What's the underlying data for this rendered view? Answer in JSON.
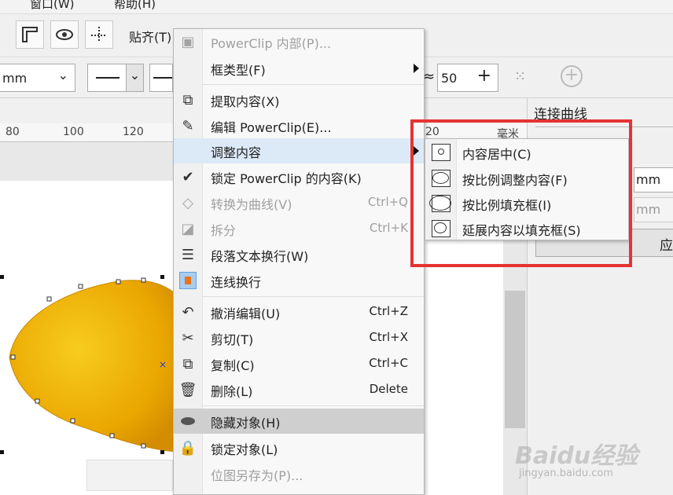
{
  "menubar": {
    "window": "窗口(W)",
    "help": "帮助(H)"
  },
  "toolbar": {
    "snap_label": "贴齐(T)",
    "unit_value": "mm",
    "spin_value": "50"
  },
  "ruler": {
    "ticks": [
      "80",
      "100",
      "120",
      "20"
    ],
    "unit": "毫米"
  },
  "docker": {
    "title": "连接曲线",
    "field_unit1": "mm",
    "field_unit2": "mm",
    "apply_label": "应"
  },
  "context_menu": {
    "items": [
      {
        "label": "PowerClip 内部(P)...",
        "shortcut": "",
        "disabled": true
      },
      {
        "label": "框类型(F)",
        "shortcut": "",
        "submenu": true
      },
      {
        "label": "提取内容(X)",
        "shortcut": ""
      },
      {
        "label": "编辑 PowerClip(E)...",
        "shortcut": ""
      },
      {
        "label": "调整内容",
        "shortcut": "",
        "submenu": true,
        "highlighted": true
      },
      {
        "label": "锁定 PowerClip 的内容(K)",
        "shortcut": "",
        "checked": true
      },
      {
        "label": "转换为曲线(V)",
        "shortcut": "Ctrl+Q",
        "disabled": true
      },
      {
        "label": "拆分",
        "shortcut": "Ctrl+K",
        "disabled": true
      },
      {
        "label": "段落文本换行(W)",
        "shortcut": ""
      },
      {
        "label": "连线换行",
        "shortcut": ""
      },
      {
        "label": "撤消编辑(U)",
        "shortcut": "Ctrl+Z"
      },
      {
        "label": "剪切(T)",
        "shortcut": "Ctrl+X"
      },
      {
        "label": "复制(C)",
        "shortcut": "Ctrl+C"
      },
      {
        "label": "删除(L)",
        "shortcut": "Delete"
      },
      {
        "label": "隐藏对象(H)",
        "shortcut": ""
      },
      {
        "label": "锁定对象(L)",
        "shortcut": ""
      },
      {
        "label": "位图另存为(P)...",
        "shortcut": "",
        "disabled": true
      }
    ]
  },
  "submenu": {
    "items": [
      {
        "label": "内容居中(C)"
      },
      {
        "label": "按比例调整内容(F)"
      },
      {
        "label": "按比例填充框(I)"
      },
      {
        "label": "延展内容以填充框(S)"
      }
    ]
  },
  "watermark": {
    "brand": "Baidu经验",
    "url": "jingyan.baidu.com"
  },
  "colors": {
    "highlight": "#dce9f7",
    "red_box": "#e63232",
    "lemon": "#f0b400"
  }
}
